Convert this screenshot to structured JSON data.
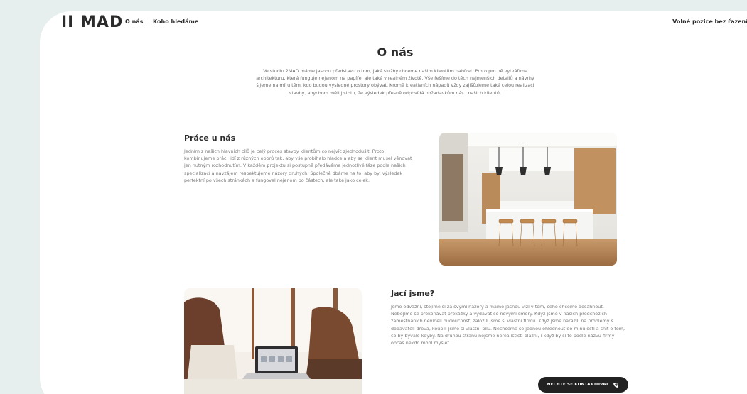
{
  "nav": {
    "logo": "II MAD",
    "links": [
      "O nás",
      "Koho hledáme"
    ],
    "right_link": "Volné pozice bez řazení"
  },
  "about": {
    "title": "O nás",
    "text": "Ve studiu 2MAD máme jasnou představu o tom, jaké služby chceme našim klientům nabízet. Proto pro ně vytváříme architekturu, která funguje nejenom na papíře, ale také v reálném životě. Vše řešíme do těch nejmenších detailů a návrhy šijeme na míru těm, kdo budou výsledné prostory obývat. Kromě kreativních nápadů vždy zajišťujeme také celou realizaci stavby, abychom měli jistotu, že výsledek přesně odpovídá požadavkům nás i našich klientů."
  },
  "work": {
    "title": "Práce u nás",
    "text": "Jedním z našich hlavních cílů je celý proces stavby klientům co nejvíc zjednodušit. Proto kombinujeme práci lidí z různých oborů tak, aby vše probíhalo hladce a aby se klient musel věnovat jen nutným rozhodnutím. V každém projektu si postupně předáváme jednotlivé fáze podle našich specializací a navzájem respektujeme názory druhých. Společně dbáme na to, aby byl výsledek perfektní po všech stránkách a fungoval nejenom po částech, ale také jako celek."
  },
  "who": {
    "title": "Jací jsme?",
    "text": "Jsme odvážní, stojíme si za svými názory a máme jasnou vizi v tom, čeho chceme dosáhnout. Nebojíme se překonávat překážky a vydávat se novými směry. Když jsme v našich předchozích zaměstnáních neviděli budoucnost, založili jsme si vlastní firmu. Když jsme narazili na problémy s dodavateli dřeva, koupili jsme si vlastní pilu. Nechceme se jednou ohlédnout do minulosti a snít o tom, co by bývalo kdyby. Na druhou stranu nejsme nerealističtí blázni, i když by si to podle názvu firmy občas někdo mohl myslet."
  },
  "cta": {
    "label": "NECHTE SE KONTAKTOVAT",
    "icon": "phone-icon"
  },
  "images": {
    "kitchen": "kitchen-photo",
    "team": "team-photo"
  },
  "colors": {
    "background": "#e6efee",
    "page": "#ffffff",
    "cta": "#222222"
  }
}
